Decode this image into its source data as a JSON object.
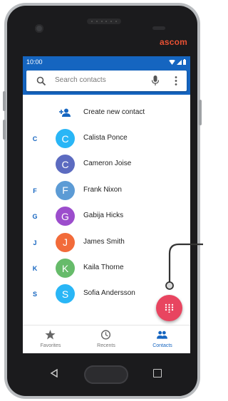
{
  "device": {
    "brand": "ascom"
  },
  "status_bar": {
    "time": "10:00"
  },
  "search": {
    "placeholder": "Search contacts"
  },
  "create_contact": {
    "label": "Create new contact"
  },
  "contacts": [
    {
      "section": "C",
      "initial": "C",
      "name": "Calista Ponce",
      "avatar_color": "#29b6f6"
    },
    {
      "section": "",
      "initial": "C",
      "name": "Cameron Joise",
      "avatar_color": "#5c6bc0"
    },
    {
      "section": "F",
      "initial": "F",
      "name": "Frank Nixon",
      "avatar_color": "#5c9bd5"
    },
    {
      "section": "G",
      "initial": "G",
      "name": "Gabija Hicks",
      "avatar_color": "#9c4dcc"
    },
    {
      "section": "J",
      "initial": "J",
      "name": "James Smith",
      "avatar_color": "#f26b3a"
    },
    {
      "section": "K",
      "initial": "K",
      "name": "Kaila Thorne",
      "avatar_color": "#66bb6a"
    },
    {
      "section": "S",
      "initial": "S",
      "name": "Sofia Andersson",
      "avatar_color": "#29b6f6"
    }
  ],
  "bottom_nav": [
    {
      "label": "Favorites",
      "icon": "star-icon",
      "active": false
    },
    {
      "label": "Recents",
      "icon": "clock-icon",
      "active": false
    },
    {
      "label": "Contacts",
      "icon": "people-icon",
      "active": true
    }
  ],
  "colors": {
    "primary": "#1565c0",
    "fab": "#e84560",
    "brand": "#e85033"
  }
}
